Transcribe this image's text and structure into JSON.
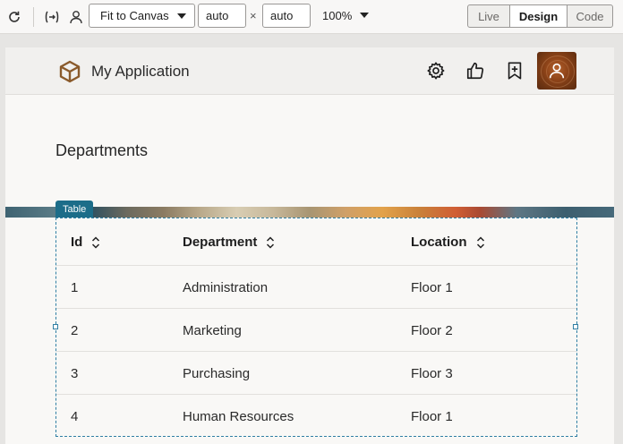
{
  "toolbar": {
    "refresh_icon": "refresh-icon",
    "variables_icon": "variables-icon",
    "user_icon": "user-icon",
    "fit_select": "Fit to Canvas",
    "width_value": "auto",
    "height_value": "auto",
    "times": "×",
    "zoom": "100%",
    "view_modes": [
      "Live",
      "Design",
      "Code"
    ],
    "active_mode": "Design"
  },
  "app": {
    "title": "My Application",
    "logo_icon": "cube-icon",
    "header_buttons": [
      "gear-icon",
      "thumbs-up-icon",
      "bookmark-add-icon"
    ],
    "avatar_icon": "user-avatar-icon"
  },
  "page": {
    "heading": "Departments",
    "component_label": "Table"
  },
  "table": {
    "columns": [
      "Id",
      "Department",
      "Location"
    ],
    "rows": [
      {
        "id": "1",
        "department": "Administration",
        "location": "Floor 1"
      },
      {
        "id": "2",
        "department": "Marketing",
        "location": "Floor 2"
      },
      {
        "id": "3",
        "department": "Purchasing",
        "location": "Floor 3"
      },
      {
        "id": "4",
        "department": "Human Resources",
        "location": "Floor 1"
      }
    ]
  },
  "colors": {
    "accent": "#1c6d89",
    "selection": "#2f7ea3",
    "logo": "#8a5a2b"
  }
}
